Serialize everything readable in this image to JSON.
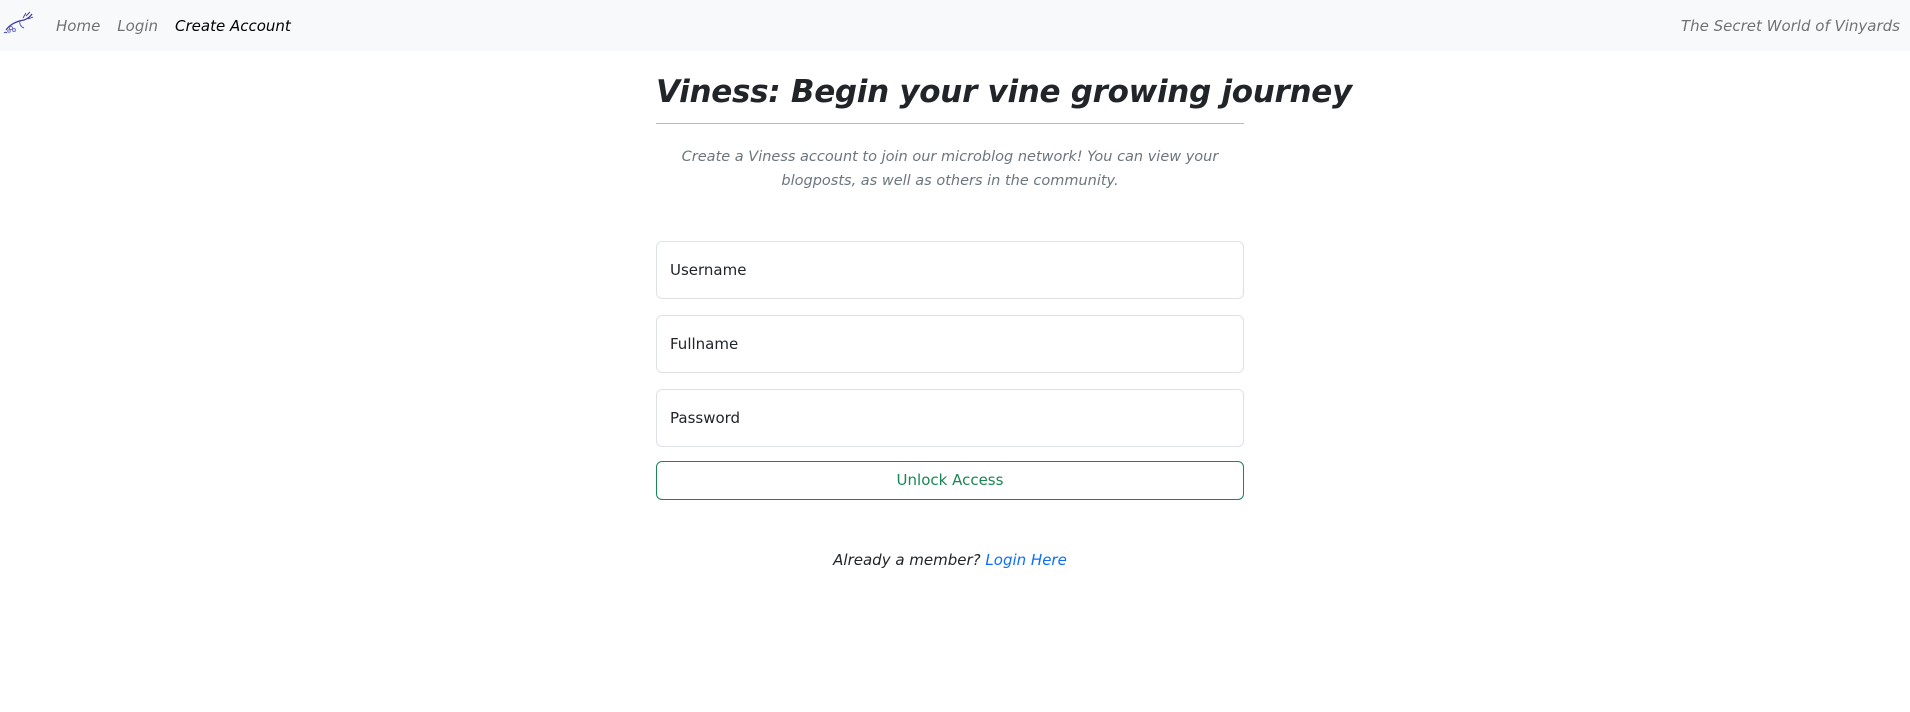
{
  "navbar": {
    "logo_icon": "grapevine-logo-icon",
    "links": [
      {
        "label": "Home",
        "active": false
      },
      {
        "label": "Login",
        "active": false
      },
      {
        "label": "Create Account",
        "active": true
      }
    ],
    "tagline": "The Secret World of Vinyards"
  },
  "main": {
    "title": "Viness: Begin your vine growing journey",
    "lead": "Create a Viness account to join our microblog network! You can view your blogposts, as well as others in the community."
  },
  "form": {
    "username_placeholder": "Username",
    "fullname_placeholder": "Fullname",
    "password_placeholder": "Password",
    "submit_label": "Unlock Access"
  },
  "footer": {
    "prompt": "Already a member?",
    "link_label": "Login Here"
  },
  "colors": {
    "navbar_bg": "#f8f9fa",
    "success": "#198754",
    "link": "#0d6efd",
    "muted": "#6c757d"
  }
}
